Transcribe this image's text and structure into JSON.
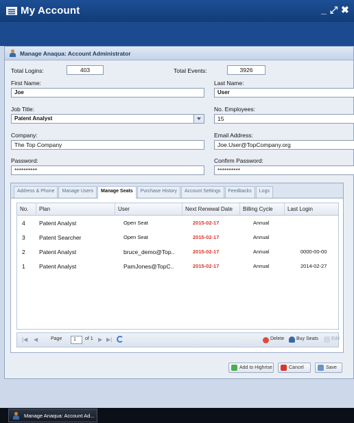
{
  "window": {
    "title": "My Account",
    "controls": [
      "_",
      "⤢",
      "✖"
    ]
  },
  "panel": {
    "title": "Manage Anaqua: Account Administrator"
  },
  "form": {
    "total_logins_label": "Total Logins:",
    "total_logins_value": "403",
    "total_events_label": "Total Events:",
    "total_events_value": "3926",
    "first_name_label": "First Name:",
    "first_name_value": "Joe",
    "last_name_label": "Last Name:",
    "last_name_value": "User",
    "job_title_label": "Job Title:",
    "job_title_value": "Patent Analyst",
    "employees_label": "No. Employees:",
    "employees_value": "15",
    "company_label": "Company:",
    "company_value": "The Top Company",
    "email_label": "Email Address:",
    "email_value": "Joe.User@TopCompany.org",
    "password_label": "Password:",
    "password_value": "**********",
    "confirm_label": "Confirm Password:",
    "confirm_value": "**********"
  },
  "tabs": [
    "Address & Phone",
    "Manage Users",
    "Manage Seats",
    "Purchase History",
    "Account Settings",
    "Feedbacks",
    "Logs"
  ],
  "active_tab": "Manage Seats",
  "grid": {
    "headers": [
      "No.",
      "Plan",
      "User",
      "Next Renewal Date",
      "Billing Cycle",
      "Last Login"
    ],
    "rows": [
      {
        "no": "4",
        "plan": "Patent Analyst",
        "user": "Open Seat",
        "renewal": "2015-02-17",
        "cycle": "Annual",
        "last_login": ""
      },
      {
        "no": "3",
        "plan": "Patent Searcher",
        "user": "Open Seat",
        "renewal": "2015-02-17",
        "cycle": "Annual",
        "last_login": ""
      },
      {
        "no": "2",
        "plan": "Patent Analyst",
        "user": "bruce_demo@Top..",
        "renewal": "2015-02-17",
        "cycle": "Annual",
        "last_login": "0000-00-00"
      },
      {
        "no": "1",
        "plan": "Patent Analyst",
        "user": "PamJones@TopC..",
        "renewal": "2015-02-17",
        "cycle": "Annual",
        "last_login": "2014-02-27"
      }
    ]
  },
  "pager": {
    "page_label": "Page",
    "page_value": "1",
    "of_label": "of 1"
  },
  "grid_actions": {
    "delete": "Delete",
    "buy_seats": "Buy Seats",
    "edit": "Edit"
  },
  "footer": {
    "add_highrise": "Add to Highrise",
    "cancel": "Cancel",
    "save": "Save"
  },
  "taskbar": {
    "item": "Manage Anaqua: Account Ad..."
  },
  "colors": {
    "accent": "#1c4a8f",
    "renewal": "#d9362b"
  }
}
